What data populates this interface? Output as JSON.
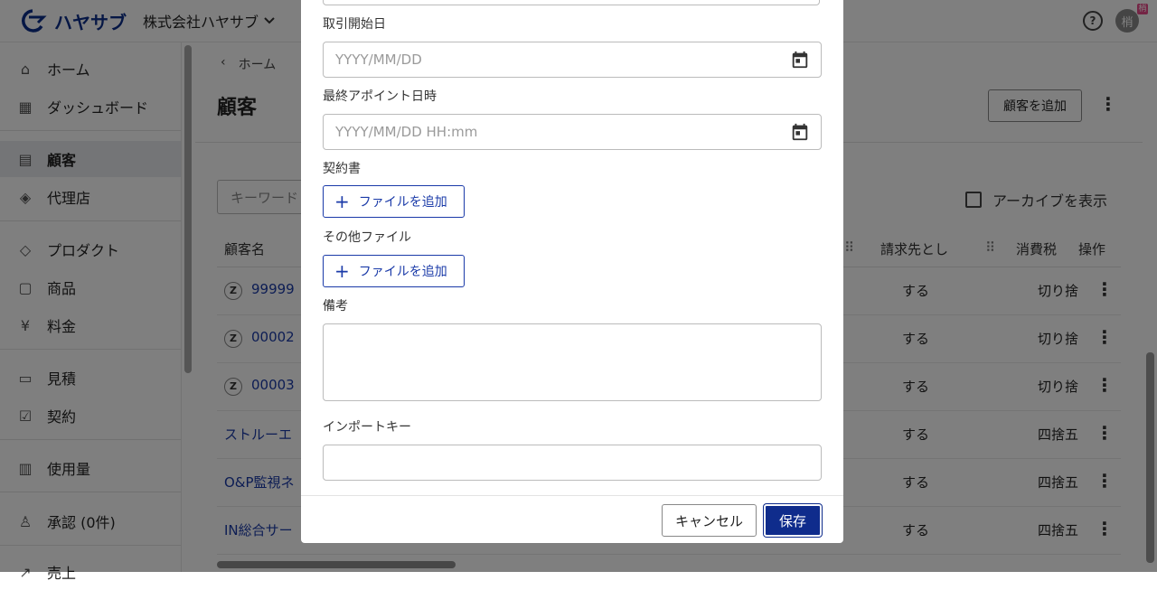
{
  "header": {
    "logo_text": "ハヤサブ",
    "company": "株式会社ハヤサブ",
    "avatar_initial": "梢",
    "avatar_badge": "梢"
  },
  "sidebar": {
    "items": [
      {
        "label": "ホーム",
        "icon": "home-icon"
      },
      {
        "label": "ダッシュボード",
        "icon": "dashboard-icon"
      },
      {
        "label": "顧客",
        "icon": "customer-icon"
      },
      {
        "label": "代理店",
        "icon": "agency-icon"
      },
      {
        "label": "プロダクト",
        "icon": "product-icon"
      },
      {
        "label": "商品",
        "icon": "goods-icon"
      },
      {
        "label": "料金",
        "icon": "yen-icon"
      },
      {
        "label": "見積",
        "icon": "estimate-icon"
      },
      {
        "label": "契約",
        "icon": "contract-icon"
      },
      {
        "label": "使用量",
        "icon": "usage-icon"
      },
      {
        "label": "承認 (0件)",
        "icon": "approval-icon"
      },
      {
        "label": "売上",
        "icon": "sales-icon"
      }
    ]
  },
  "main": {
    "breadcrumb": "ホーム",
    "title": "顧客",
    "add_button": "顧客を追加",
    "keyword_placeholder": "キーワード",
    "archive_label": "アーカイブを表示",
    "columns": [
      "顧客名",
      "請求先とし",
      "消費税",
      "操作"
    ],
    "rows": [
      {
        "name": "99999 ",
        "badge": "Z",
        "billing": "する",
        "tax": "切り捨"
      },
      {
        "name": "00002 ",
        "badge": "Z",
        "billing": "する",
        "tax": "切り捨"
      },
      {
        "name": "00003 ",
        "badge": "Z",
        "billing": "する",
        "tax": "切り捨"
      },
      {
        "name": "ストルーエ",
        "badge": "",
        "billing": "する",
        "tax": "四捨五"
      },
      {
        "name": "O&P監視ネ",
        "badge": "",
        "billing": "する",
        "tax": "四捨五"
      },
      {
        "name": "IN総合サー",
        "badge": "",
        "billing": "する",
        "tax": "四捨五"
      }
    ]
  },
  "dialog": {
    "start_date_label": "取引開始日",
    "start_date_placeholder": "YYYY/MM/DD",
    "last_appt_label": "最終アポイント日時",
    "last_appt_placeholder": "YYYY/MM/DD HH:mm",
    "contract_label": "契約書",
    "other_files_label": "その他ファイル",
    "add_file": "ファイルを追加",
    "notes_label": "備考",
    "import_key_label": "インポートキー",
    "cancel": "キャンセル",
    "save": "保存"
  },
  "colors": {
    "brand": "#0f2c8c",
    "link": "#1a3aa8"
  }
}
